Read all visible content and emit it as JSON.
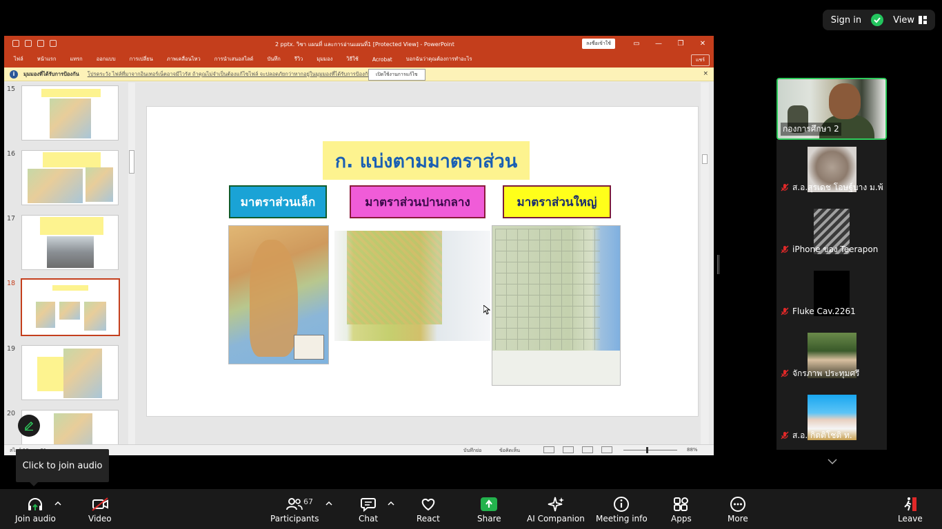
{
  "zoom_top": {
    "sign_in": "Sign in",
    "view": "View"
  },
  "ppt": {
    "title": "2 pptx. วิชา แผนที่ และการอ่านแผนที่1 [Protected View]  -  PowerPoint",
    "sign_in_btn": "ลงชื่อเข้าใช้",
    "menu": [
      "ไฟล์",
      "หน้าแรก",
      "แทรก",
      "ออกแบบ",
      "การเปลี่ยน",
      "ภาพเคลื่อนไหว",
      "การนำเสนอสไลด์",
      "บันทึก",
      "รีวิว",
      "มุมมอง",
      "วิธีใช้",
      "Acrobat",
      "บอกฉันว่าคุณต้องการทำอะไร"
    ],
    "share_btn": "แชร์",
    "protected": {
      "label": "มุมมองที่ได้รับการป้องกัน",
      "message": "โปรดระวัง ไฟล์ที่มาจากอินเทอร์เน็ตอาจมีไวรัส ถ้าคุณไม่จำเป็นต้องแก้ไขไฟล์ จะปลอดภัยกว่าหากอยู่ในมุมมองที่ได้รับการป้องกัน",
      "enable_btn": "เปิดใช้งานการแก้ไข",
      "close": "×"
    },
    "thumbs": [
      {
        "num": "15",
        "active": false
      },
      {
        "num": "16",
        "active": false
      },
      {
        "num": "17",
        "active": false
      },
      {
        "num": "18",
        "active": true
      },
      {
        "num": "19",
        "active": false
      },
      {
        "num": "20",
        "active": false
      }
    ],
    "slide": {
      "title": "ก. แบ่งตามมาตราส่วน",
      "cat_small": "มาตราส่วนเล็ก",
      "cat_mid": "มาตราส่วนปานกลาง",
      "cat_large": "มาตราส่วนใหญ่"
    },
    "status": {
      "left": "สไลด์ 18 จาก 21",
      "notes": "บันทึกย่อ",
      "comments": "ข้อคิดเห็น",
      "zoom": "88%"
    }
  },
  "tooltip": "Click to join audio",
  "active_speaker": {
    "name": "กองการศึกษา 2"
  },
  "participants": [
    {
      "name": "ส.อ.สุรเดช โอษฐ์บาง ม.พ้...",
      "pic": "seal"
    },
    {
      "name": "iPhone ของ Teerapon",
      "pic": "blinds"
    },
    {
      "name": "Fluke Cav.2261",
      "pic": "black"
    },
    {
      "name": "จักรภาพ ประทุมศรี",
      "pic": "photo"
    },
    {
      "name": "ส.อ. กิตติโชติ ท.",
      "pic": "portrait"
    }
  ],
  "toolbar": {
    "join_audio": "Join audio",
    "video": "Video",
    "participants": "Participants",
    "participants_count": "67",
    "chat": "Chat",
    "react": "React",
    "share": "Share",
    "ai_companion": "AI Companion",
    "meeting_info": "Meeting info",
    "apps": "Apps",
    "more": "More",
    "leave": "Leave"
  },
  "colors": {
    "ppt_red": "#c43e1c",
    "active_green": "#2ecc5c",
    "share_green": "#23b24d",
    "leave_red": "#e02828"
  }
}
